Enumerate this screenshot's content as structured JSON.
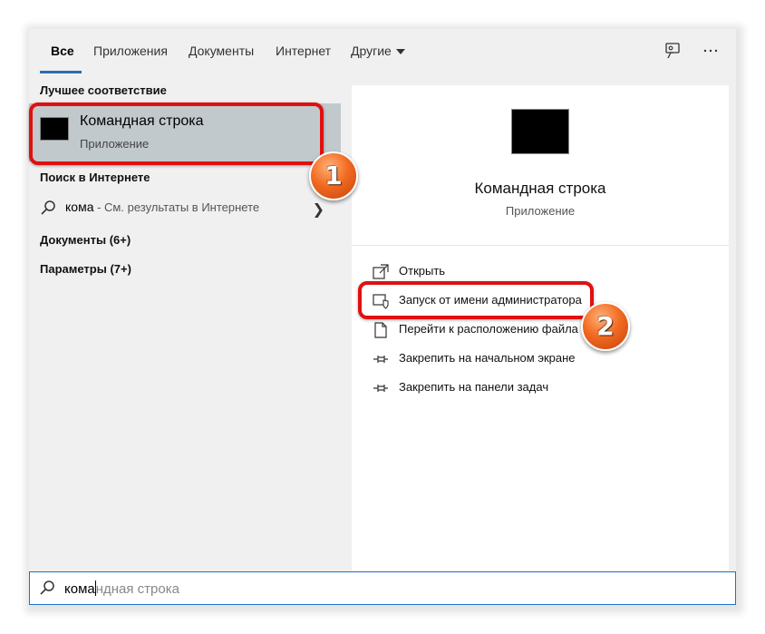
{
  "tabs": {
    "all": "Все",
    "apps": "Приложения",
    "documents": "Документы",
    "internet": "Интернет",
    "other": "Другие"
  },
  "left": {
    "best_match_header": "Лучшее соответствие",
    "best_match": {
      "title": "Командная строка",
      "subtitle": "Приложение"
    },
    "web_header": "Поиск в Интернете",
    "web_result": {
      "query": "кома",
      "hint": " - См. результаты в Интернете"
    },
    "documents": "Документы (6+)",
    "settings": "Параметры (7+)"
  },
  "preview": {
    "title": "Командная строка",
    "subtitle": "Приложение",
    "actions": [
      {
        "label": "Открыть",
        "icon": "open-icon"
      },
      {
        "label": "Запуск от имени администратора",
        "icon": "run-as-admin-icon"
      },
      {
        "label": "Перейти к расположению файла",
        "icon": "file-location-icon"
      },
      {
        "label": "Закрепить на начальном экране",
        "icon": "pin-icon"
      },
      {
        "label": "Закрепить на панели задач",
        "icon": "pin-icon"
      }
    ]
  },
  "search": {
    "typed": "кома",
    "suggestion": "ндная строка"
  },
  "annotations": {
    "badge1": "1",
    "badge2": "2",
    "highlight_color": "#e11010",
    "badge_color": "#f26b22"
  },
  "colors": {
    "accent": "#2b6cb0",
    "selected_bg": "#c2c9cc",
    "search_border": "#1a73c9"
  }
}
